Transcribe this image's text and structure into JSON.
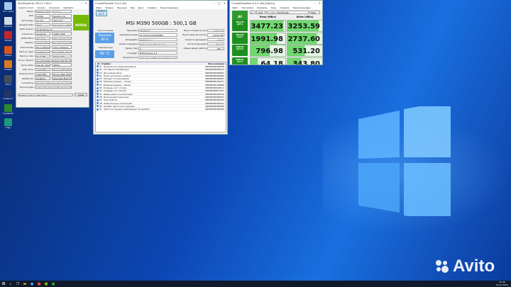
{
  "desktop": {
    "icons": [
      {
        "label": "Этот компьютер",
        "icon": "computer-icon",
        "color": "#9ec9f0"
      },
      {
        "label": "Корзина",
        "icon": "recycle-bin-icon",
        "color": "#d0dbe6"
      },
      {
        "label": "AIDA64",
        "icon": "aida64-icon",
        "color": "#c0282c"
      },
      {
        "label": "3DMark",
        "icon": "3dmark-icon",
        "color": "#e0541a"
      },
      {
        "label": "FurMark",
        "icon": "furmark-icon",
        "color": "#d87a1e"
      },
      {
        "label": "GPU-Z",
        "icon": "gpuz-icon",
        "color": "#444d5a"
      },
      {
        "label": "Cinebench",
        "icon": "cinebench-icon",
        "color": "#223366"
      },
      {
        "label": "CrystalDiskMark",
        "icon": "crystaldiskmark-icon",
        "color": "#2c8a2c"
      },
      {
        "label": "Edge",
        "icon": "edge-icon",
        "color": "#1a9a7a"
      }
    ],
    "watermark": "Avito",
    "watermark_color": "#ffffff"
  },
  "gpuz": {
    "title": "TechPowerUp GPU-Z 2.60.0",
    "tabs": [
      "Graphics Card",
      "Sensors",
      "Advanced",
      "Validation"
    ],
    "rows": [
      {
        "label": "Name",
        "value": "NVIDIA GeForce RTX 2060",
        "extra": "Lookup"
      },
      {
        "label": "GPU",
        "value": "TU106",
        "extra": "Revision A1"
      },
      {
        "label": "Technology",
        "value": "12 nm",
        "extra": "445 mm²"
      },
      {
        "label": "Release Date",
        "value": "2019",
        "extra": "Transistors 10800M"
      },
      {
        "label": "BIOS Version",
        "value": "90.06.3E.00.70"
      },
      {
        "label": "Subvendor",
        "value": "Gigabyte",
        "extra": "10DE 1F08"
      },
      {
        "label": "ROPs/TMUs",
        "value": "48 / 120",
        "extra": "PCIe x16 3.0 @ x16 1.1"
      },
      {
        "label": "Shaders",
        "value": "1920 Unified",
        "extra": "DirectX 12 (12_2)"
      },
      {
        "label": "Pixel Fillrate",
        "value": "80.2 GPixel/s",
        "extra": "160.3 GTexel/s"
      },
      {
        "label": "Memory Type",
        "value": "GDDR6 (Samsung)",
        "extra": "Bus Width 192 bit"
      },
      {
        "label": "Memory Size",
        "value": "6144 MB",
        "extra": "336.0 GB/s"
      },
      {
        "label": "Driver Version",
        "value": "32.0.15.6590 (NVIDIA 565.90) DCH"
      },
      {
        "label": "Driver Date",
        "value": "Sep 26, 2024",
        "extra": "WHQL"
      },
      {
        "label": "GPU Clock",
        "value": "1365 MHz",
        "extra": "Boost 1680 MHz"
      },
      {
        "label": "Default Clock",
        "value": "1365 MHz",
        "extra": "Boost 1680 MHz"
      },
      {
        "label": "NVIDIA SLI",
        "value": "Disabled",
        "extra": "Resizable BAR Disabled"
      },
      {
        "label": "Computing",
        "value": "OpenCL CUDA DirectCompute DirectML"
      },
      {
        "label": "Technologies",
        "value": "Vulkan Ray Tracing PhysX OpenGL 4.6"
      }
    ],
    "selected_card": "NVIDIA GeForce RTX 2060",
    "close_label": "Close",
    "logo": "NVIDIA"
  },
  "cdi": {
    "title": "CrystalDiskInfo 9.4.4 x64",
    "menu": [
      "Файл",
      "Правка",
      "Функции",
      "Вид",
      "Диск",
      "Справка",
      "Язык(Language)"
    ],
    "drive_tab": "Хорошо 49 °C",
    "drive_title": "MSI M390 500GB : 500,1 GB",
    "health_label": "Техсостояние",
    "health_status": "Хорошо",
    "health_percent": "99 %",
    "temp_label": "Температура",
    "temp_value": "49 °C",
    "info": [
      {
        "label": "Прошивка",
        "value": "SHXM023",
        "rlabel": "Всего чтений хостом",
        "rvalue": "8300 GB"
      },
      {
        "label": "Серийный номер",
        "value": "511221121310000865",
        "rlabel": "Всего записей хостом",
        "rvalue": "11028 GB"
      },
      {
        "label": "Интерфейс",
        "value": "NVM Express",
        "rlabel": "Скорость вращения",
        "rvalue": "---- (SSD)"
      },
      {
        "label": "Режим передачи",
        "value": "PCIe 3.0 x4 | PCIe 3.0 x4",
        "rlabel": "Число включений",
        "rvalue": "83 раз"
      },
      {
        "label": "Буква тома",
        "value": "C:",
        "rlabel": "Общее время работы",
        "rvalue": "845 ч"
      },
      {
        "label": "Стандарт",
        "value": "NVM Express 1.4",
        "rlabel": "",
        "rvalue": ""
      },
      {
        "label": "Возможности",
        "value": "S.M.A.R.T., TRIM, VolatileWriteCache",
        "rlabel": "",
        "rvalue": ""
      }
    ],
    "table_headers": [
      "ID",
      "Атрибут",
      "Raw-значения"
    ],
    "attributes": [
      {
        "id": "01",
        "name": "Критические предупреждения",
        "raw": "0000000000000000"
      },
      {
        "id": "02",
        "name": "Составная температура",
        "raw": "0000000000000142"
      },
      {
        "id": "03",
        "name": "Доступный запас",
        "raw": "0000000000000064"
      },
      {
        "id": "04",
        "name": "Порог доступного запаса",
        "raw": "0000000000000005"
      },
      {
        "id": "05",
        "name": "Процент использования",
        "raw": "0000000000000001"
      },
      {
        "id": "06",
        "name": "Единицы данных - чтение",
        "raw": "000000000109AF73"
      },
      {
        "id": "07",
        "name": "Единицы данных - запись",
        "raw": "0000000001589B2E"
      },
      {
        "id": "08",
        "name": "Команды хост-чтения",
        "raw": "0000000009A8E1C4"
      },
      {
        "id": "09",
        "name": "Команды хост-записи",
        "raw": "000000000BF41A97"
      },
      {
        "id": "0A",
        "name": "Время работы контроллера",
        "raw": "00000000000003A6"
      },
      {
        "id": "0B",
        "name": "Включения/отключения",
        "raw": "0000000000000053"
      },
      {
        "id": "0C",
        "name": "Часы работы",
        "raw": "000000000000034D"
      },
      {
        "id": "0D",
        "name": "Небезопасные отключения",
        "raw": "0000000000000014"
      },
      {
        "id": "0E",
        "name": "Ошибки целостности данных",
        "raw": "0000000000000000"
      },
      {
        "id": "0F",
        "name": "Записи в журнале информации об ошибках",
        "raw": "0000000000000000"
      }
    ]
  },
  "cdm": {
    "title": "CrystalDiskMark 8.0.5 x64 [Admin]",
    "menu": [
      "Файл",
      "Настройки",
      "Профиль",
      "Тема",
      "Справка",
      "Язык(Language)"
    ],
    "all_label": "All",
    "count": "5",
    "size": "1GiB",
    "drive": "C: 17% (78/465GiB)",
    "unit": "MB/s",
    "read_header": "Read (MB/s)",
    "write_header": "Write (MB/s)",
    "tests": [
      {
        "line1": "SEQ1M",
        "line2": "Q8T1",
        "read": "3477.23",
        "write": "3253.59",
        "read_fill": 0.95,
        "write_fill": 0.9
      },
      {
        "line1": "SEQ1M",
        "line2": "Q1T1",
        "read": "1991.98",
        "write": "2737.60",
        "read_fill": 0.75,
        "write_fill": 0.85
      },
      {
        "line1": "RND4K",
        "line2": "Q32T1",
        "read": "796.98",
        "write": "531.20",
        "read_fill": 0.55,
        "write_fill": 0.5
      },
      {
        "line1": "RND4K",
        "line2": "Q1T1",
        "read": "64.18",
        "write": "343.80",
        "read_fill": 0.2,
        "write_fill": 0.4
      }
    ]
  },
  "taskbar": {
    "time": "21:46",
    "date": "02.10.2024"
  }
}
